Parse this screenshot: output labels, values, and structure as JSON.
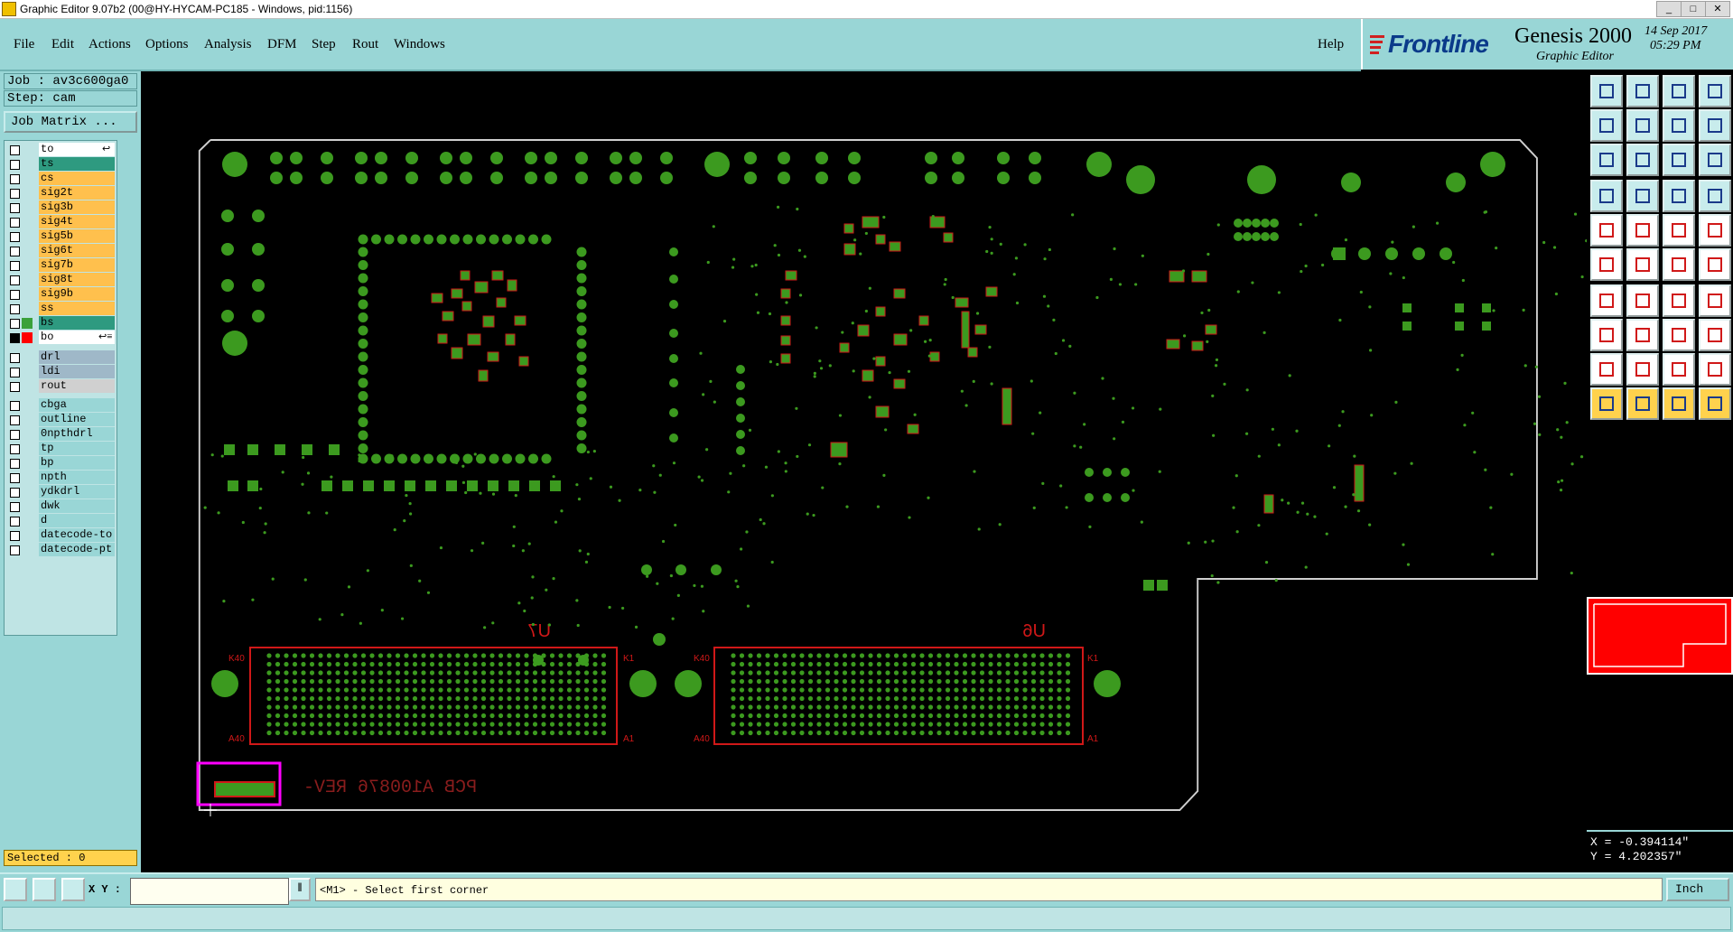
{
  "window": {
    "title": "Graphic Editor 9.07b2 (00@HY-HYCAM-PC185 - Windows, pid:1156)",
    "controls": [
      "_",
      "□",
      "✕"
    ]
  },
  "menu": [
    "File",
    "Edit",
    "Actions",
    "Options",
    "Analysis",
    "DFM",
    "Step",
    "Rout",
    "Windows"
  ],
  "help": "Help",
  "brand": {
    "logo": "Frontline",
    "product": "Genesis 2000",
    "subtitle": "Graphic Editor",
    "date": "14 Sep 2017",
    "time": "05:29 PM"
  },
  "job": {
    "job_label": "Job : av3c600ga0",
    "step_label": "Step: cam",
    "matrix_button": "Job Matrix ..."
  },
  "layers": {
    "board": [
      {
        "name": "to",
        "color": "#ffffff",
        "tag": "↩"
      },
      {
        "name": "ts",
        "color": "#2e9a80"
      },
      {
        "name": "cs",
        "color": "#ffc04d"
      },
      {
        "name": "sig2t",
        "color": "#ffc04d"
      },
      {
        "name": "sig3b",
        "color": "#ffc04d"
      },
      {
        "name": "sig4t",
        "color": "#ffc04d"
      },
      {
        "name": "sig5b",
        "color": "#ffc04d"
      },
      {
        "name": "sig6t",
        "color": "#ffc04d"
      },
      {
        "name": "sig7b",
        "color": "#ffc04d"
      },
      {
        "name": "sig8t",
        "color": "#ffc04d"
      },
      {
        "name": "sig9b",
        "color": "#ffc04d"
      },
      {
        "name": "ss",
        "color": "#ffc04d"
      },
      {
        "name": "bs",
        "color": "#2e9a80",
        "swatch": "#3aa13a"
      },
      {
        "name": "bo",
        "color": "#ffffff",
        "swatch": "#ff0000",
        "tag": "↩≡",
        "active": true
      }
    ],
    "drill": [
      {
        "name": "drl",
        "color": "#9fb8c8"
      },
      {
        "name": "ldi",
        "color": "#9fb8c8"
      },
      {
        "name": "rout",
        "color": "#d0d0d0"
      }
    ],
    "misc": [
      {
        "name": "cbga"
      },
      {
        "name": "outline"
      },
      {
        "name": "0npthdrl"
      },
      {
        "name": "tp"
      },
      {
        "name": "bp"
      },
      {
        "name": "npth"
      },
      {
        "name": "ydkdrl"
      },
      {
        "name": "dwk"
      },
      {
        "name": "d"
      },
      {
        "name": "datecode-to"
      },
      {
        "name": "datecode-pt"
      }
    ]
  },
  "selected": "Selected : 0",
  "board_labels": {
    "u7": "U7",
    "u6": "U6",
    "pcb_text": "PCB A100876 REV-",
    "pin_k40": "K40",
    "pin_k1": "K1",
    "pin_a40": "A40",
    "pin_a1": "A1"
  },
  "coords": {
    "x": "X = -0.394114\"",
    "y": "Y =  4.202357\""
  },
  "bottom": {
    "xy_label": "X Y :",
    "xy_value": "",
    "prompt": "<M1> - Select first corner",
    "units": "Inch"
  }
}
